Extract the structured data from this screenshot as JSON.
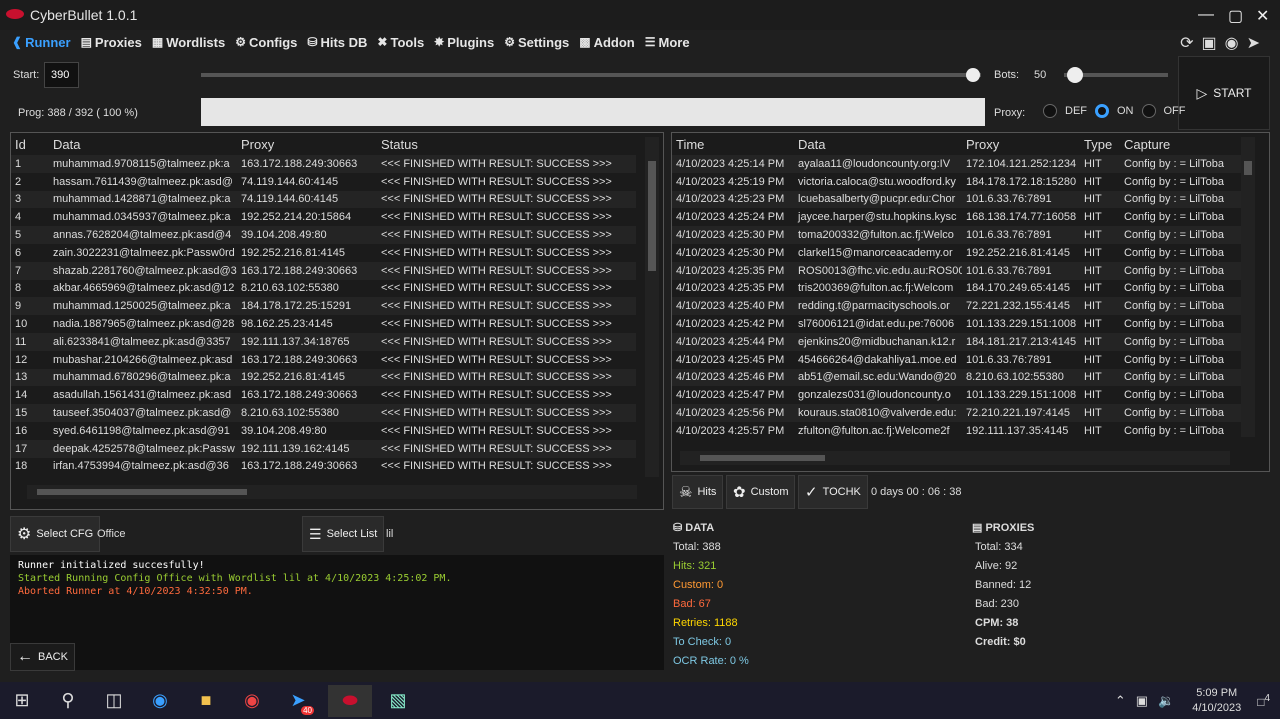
{
  "app": {
    "title": "CyberBullet 1.0.1"
  },
  "nav": [
    {
      "label": "Runner",
      "icon": "runner-icon"
    },
    {
      "label": "Proxies",
      "icon": "server-icon"
    },
    {
      "label": "Wordlists",
      "icon": "book-icon"
    },
    {
      "label": "Configs",
      "icon": "gear-icon"
    },
    {
      "label": "Hits DB",
      "icon": "database-icon"
    },
    {
      "label": "Tools",
      "icon": "tools-icon"
    },
    {
      "label": "Plugins",
      "icon": "plugin-icon"
    },
    {
      "label": "Settings",
      "icon": "settings-icon"
    },
    {
      "label": "Addon",
      "icon": "addon-icon"
    },
    {
      "label": "More",
      "icon": "menu-icon"
    }
  ],
  "controls": {
    "start_label": "Start:",
    "start_value": "390",
    "bots_label": "Bots:",
    "bots_value": "50",
    "prog_label": "Prog: 388 / 392 ( 100 %)",
    "progress": 0.99,
    "proxy_label": "Proxy:",
    "proxy_options": [
      "DEF",
      "ON",
      "OFF"
    ],
    "proxy_selected": "ON",
    "start_button": "START"
  },
  "runner_table": {
    "columns": [
      "Id",
      "Data",
      "Proxy",
      "Status"
    ],
    "rows": [
      [
        "1",
        "muhammad.9708115@talmeez.pk:a",
        "163.172.188.249:30663",
        "<<< FINISHED WITH RESULT: SUCCESS >>>"
      ],
      [
        "2",
        "hassam.7611439@talmeez.pk:asd@",
        "74.119.144.60:4145",
        "<<< FINISHED WITH RESULT: SUCCESS >>>"
      ],
      [
        "3",
        "muhammad.1428871@talmeez.pk:a",
        "74.119.144.60:4145",
        "<<< FINISHED WITH RESULT: SUCCESS >>>"
      ],
      [
        "4",
        "muhammad.0345937@talmeez.pk:a",
        "192.252.214.20:15864",
        "<<< FINISHED WITH RESULT: SUCCESS >>>"
      ],
      [
        "5",
        "annas.7628204@talmeez.pk:asd@4",
        "39.104.208.49:80",
        "<<< FINISHED WITH RESULT: SUCCESS >>>"
      ],
      [
        "6",
        "zain.3022231@talmeez.pk:Passw0rd",
        "192.252.216.81:4145",
        "<<< FINISHED WITH RESULT: SUCCESS >>>"
      ],
      [
        "7",
        "shazab.2281760@talmeez.pk:asd@3",
        "163.172.188.249:30663",
        "<<< FINISHED WITH RESULT: SUCCESS >>>"
      ],
      [
        "8",
        "akbar.4665969@talmeez.pk:asd@12",
        "8.210.63.102:55380",
        "<<< FINISHED WITH RESULT: SUCCESS >>>"
      ],
      [
        "9",
        "muhammad.1250025@talmeez.pk:a",
        "184.178.172.25:15291",
        "<<< FINISHED WITH RESULT: SUCCESS >>>"
      ],
      [
        "10",
        "nadia.1887965@talmeez.pk:asd@28",
        "98.162.25.23:4145",
        "<<< FINISHED WITH RESULT: SUCCESS >>>"
      ],
      [
        "11",
        "ali.6233841@talmeez.pk:asd@3357",
        "192.111.137.34:18765",
        "<<< FINISHED WITH RESULT: SUCCESS >>>"
      ],
      [
        "12",
        "mubashar.2104266@talmeez.pk:asd",
        "163.172.188.249:30663",
        "<<< FINISHED WITH RESULT: SUCCESS >>>"
      ],
      [
        "13",
        "muhammad.6780296@talmeez.pk:a",
        "192.252.216.81:4145",
        "<<< FINISHED WITH RESULT: SUCCESS >>>"
      ],
      [
        "14",
        "asadullah.1561431@talmeez.pk:asd",
        "163.172.188.249:30663",
        "<<< FINISHED WITH RESULT: SUCCESS >>>"
      ],
      [
        "15",
        "tauseef.3504037@talmeez.pk:asd@",
        "8.210.63.102:55380",
        "<<< FINISHED WITH RESULT: SUCCESS >>>"
      ],
      [
        "16",
        "syed.6461198@talmeez.pk:asd@91",
        "39.104.208.49:80",
        "<<< FINISHED WITH RESULT: SUCCESS >>>"
      ],
      [
        "17",
        "deepak.4252578@talmeez.pk:Passw",
        "192.111.139.162:4145",
        "<<< FINISHED WITH RESULT: SUCCESS >>>"
      ],
      [
        "18",
        "irfan.4753994@talmeez.pk:asd@36",
        "163.172.188.249:30663",
        "<<< FINISHED WITH RESULT: SUCCESS >>>"
      ]
    ]
  },
  "hits_table": {
    "columns": [
      "Time",
      "Data",
      "Proxy",
      "Type",
      "Capture"
    ],
    "rows": [
      [
        "4/10/2023 4:25:14 PM",
        "ayalaa11@loudoncounty.org:IV",
        "172.104.121.252:1234",
        "HIT",
        "Config by : = LilToba"
      ],
      [
        "4/10/2023 4:25:19 PM",
        "victoria.caloca@stu.woodford.ky",
        "184.178.172.18:15280",
        "HIT",
        "Config by : = LilToba"
      ],
      [
        "4/10/2023 4:25:23 PM",
        "lcuebasalberty@pucpr.edu:Chor",
        "101.6.33.76:7891",
        "HIT",
        "Config by : = LilToba"
      ],
      [
        "4/10/2023 4:25:24 PM",
        "jaycee.harper@stu.hopkins.kysc",
        "168.138.174.77:16058",
        "HIT",
        "Config by : = LilToba"
      ],
      [
        "4/10/2023 4:25:30 PM",
        "toma200332@fulton.ac.fj:Welco",
        "101.6.33.76:7891",
        "HIT",
        "Config by : = LilToba"
      ],
      [
        "4/10/2023 4:25:30 PM",
        "clarkel15@manorceacademy.or",
        "192.252.216.81:4145",
        "HIT",
        "Config by : = LilToba"
      ],
      [
        "4/10/2023 4:25:35 PM",
        "ROS0013@fhc.vic.edu.au:ROS00",
        "101.6.33.76:7891",
        "HIT",
        "Config by : = LilToba"
      ],
      [
        "4/10/2023 4:25:35 PM",
        "tris200369@fulton.ac.fj:Welcom",
        "184.170.249.65:4145",
        "HIT",
        "Config by : = LilToba"
      ],
      [
        "4/10/2023 4:25:40 PM",
        "redding.t@parmacityschools.or",
        "72.221.232.155:4145",
        "HIT",
        "Config by : = LilToba"
      ],
      [
        "4/10/2023 4:25:42 PM",
        "sl76006121@idat.edu.pe:76006",
        "101.133.229.151:1008",
        "HIT",
        "Config by : = LilToba"
      ],
      [
        "4/10/2023 4:25:44 PM",
        "ejenkins20@midbuchanan.k12.r",
        "184.181.217.213:4145",
        "HIT",
        "Config by : = LilToba"
      ],
      [
        "4/10/2023 4:25:45 PM",
        "454666264@dakahliya1.moe.ed",
        "101.6.33.76:7891",
        "HIT",
        "Config by : = LilToba"
      ],
      [
        "4/10/2023 4:25:46 PM",
        "ab51@email.sc.edu:Wando@20",
        "8.210.63.102:55380",
        "HIT",
        "Config by : = LilToba"
      ],
      [
        "4/10/2023 4:25:47 PM",
        "gonzalezs031@loudoncounty.o",
        "101.133.229.151:1008",
        "HIT",
        "Config by : = LilToba"
      ],
      [
        "4/10/2023 4:25:56 PM",
        "kouraus.sta0810@valverde.edu:",
        "72.210.221.197:4145",
        "HIT",
        "Config by : = LilToba"
      ],
      [
        "4/10/2023 4:25:57 PM",
        "zfulton@fulton.ac.fj:Welcome2f",
        "192.111.137.35:4145",
        "HIT",
        "Config by : = LilToba"
      ]
    ]
  },
  "hits_buttons": {
    "hits": "Hits",
    "custom": "Custom",
    "tochk": "TOCHK",
    "elapsed": "0  days  00 : 06 : 38"
  },
  "config": {
    "select_cfg": "Select CFG",
    "cfg_name": "Office",
    "select_list": "Select List",
    "list_name": "lil"
  },
  "log": [
    {
      "text": "Runner initialized succesfully!",
      "color": "#ffffff"
    },
    {
      "text": "Started Running Config Office with Wordlist lil at 4/10/2023 4:25:02 PM.",
      "color": "#9acd32"
    },
    {
      "text": "Aborted Runner at 4/10/2023 4:32:50 PM.",
      "color": "#ff6a3d"
    }
  ],
  "back": "BACK",
  "data_stats": {
    "title": "DATA",
    "items": [
      {
        "text": "Total:  388",
        "color": "#dddddd"
      },
      {
        "text": "Hits:  321",
        "color": "#9acd32"
      },
      {
        "text": "Custom:  0",
        "color": "#ff9933"
      },
      {
        "text": "Bad:  67",
        "color": "#ff6a3d"
      },
      {
        "text": "Retries:  1188",
        "color": "#ffd700"
      },
      {
        "text": "To Check:  0",
        "color": "#7ec8e3"
      },
      {
        "text": "OCR Rate:  0 %",
        "color": "#7ec8e3"
      }
    ]
  },
  "proxy_stats": {
    "title": "PROXIES",
    "items": [
      {
        "text": "Total:  334",
        "bold": false
      },
      {
        "text": "Alive:  92",
        "bold": false
      },
      {
        "text": "Banned:  12",
        "bold": false
      },
      {
        "text": "Bad:  230",
        "bold": false
      },
      {
        "text": "CPM:  38",
        "bold": true
      },
      {
        "text": "Credit:  $0",
        "bold": true
      }
    ]
  },
  "taskbar": {
    "time": "5:09 PM",
    "date": "4/10/2023",
    "telegram_badge": "40",
    "notif_count": "4"
  }
}
